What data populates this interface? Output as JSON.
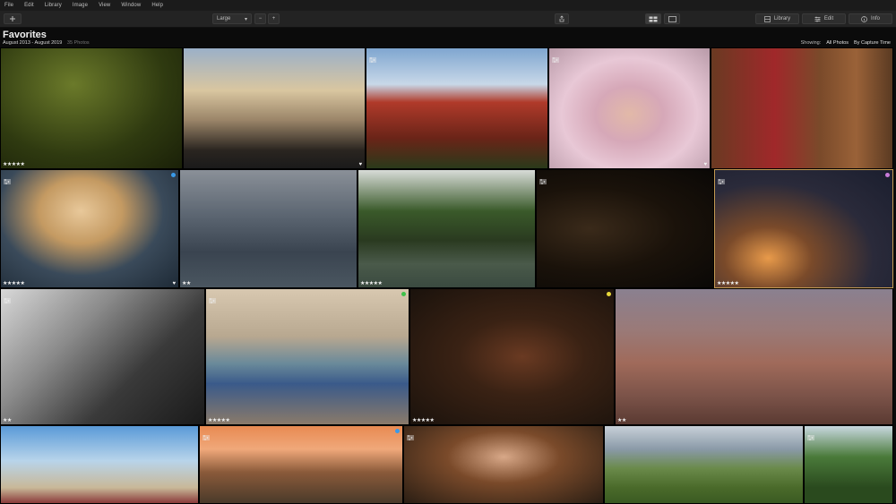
{
  "menu": [
    "File",
    "Edit",
    "Library",
    "Image",
    "View",
    "Window",
    "Help"
  ],
  "toolbar": {
    "add_icon": "plus-icon",
    "size_label": "Large",
    "size_arrow": "▾",
    "minus": "−",
    "plus": "+",
    "share_icon": "share-icon",
    "library_label": "Library",
    "edit_label": "Edit",
    "info_label": "Info"
  },
  "header": {
    "title": "Favorites",
    "date_range": "August 2013 - August 2019",
    "count": "35 Photos",
    "showing_label": "Showing:",
    "showing_value": "All Photos",
    "sort_value": "By Capture Time"
  },
  "tiles": [
    {
      "rating": "★★★★★",
      "heart": "",
      "edited": false,
      "dot": ""
    },
    {
      "rating": "",
      "heart": "♥",
      "edited": false,
      "dot": ""
    },
    {
      "rating": "",
      "heart": "",
      "edited": true,
      "dot": ""
    },
    {
      "rating": "",
      "heart": "♥",
      "edited": true,
      "dot": ""
    },
    {
      "rating": "",
      "heart": "",
      "edited": false,
      "dot": ""
    },
    {
      "rating": "★★★★★",
      "heart": "♥",
      "edited": true,
      "dot": "blue"
    },
    {
      "rating": "★★",
      "heart": "",
      "edited": false,
      "dot": ""
    },
    {
      "rating": "★★★★★",
      "heart": "",
      "edited": false,
      "dot": ""
    },
    {
      "rating": "",
      "heart": "",
      "edited": true,
      "dot": ""
    },
    {
      "rating": "★★★★★",
      "heart": "",
      "edited": true,
      "dot": "purple"
    },
    {
      "rating": "★★",
      "heart": "",
      "edited": true,
      "dot": ""
    },
    {
      "rating": "★★★★★",
      "heart": "",
      "edited": true,
      "dot": "green"
    },
    {
      "rating": "★★★★★",
      "heart": "",
      "edited": false,
      "dot": "yellow"
    },
    {
      "rating": "★★",
      "heart": "",
      "edited": false,
      "dot": ""
    },
    {
      "rating": "",
      "heart": "",
      "edited": false,
      "dot": ""
    },
    {
      "rating": "",
      "heart": "",
      "edited": true,
      "dot": "blue"
    },
    {
      "rating": "",
      "heart": "",
      "edited": true,
      "dot": ""
    },
    {
      "rating": "",
      "heart": "",
      "edited": false,
      "dot": ""
    },
    {
      "rating": "",
      "heart": "",
      "edited": true,
      "dot": ""
    }
  ]
}
